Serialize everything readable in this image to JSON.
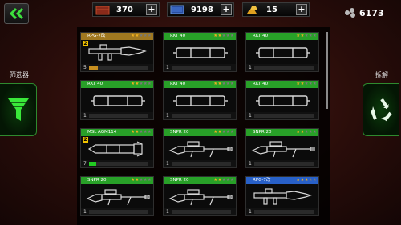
{
  "topbar": {
    "resources": [
      {
        "name": "crate",
        "value": "370",
        "plus": "+"
      },
      {
        "name": "cash",
        "value": "9198",
        "plus": "+"
      },
      {
        "name": "gold-bars",
        "value": "15",
        "plus": "+"
      }
    ],
    "balance": "6173"
  },
  "filter": {
    "label": "筛选器"
  },
  "disassemble": {
    "label": "拆解"
  },
  "cards": [
    {
      "name": "RPG-7改",
      "stars": 2,
      "header_color": "#a07820",
      "level": "2",
      "count": "5",
      "bar": 0.15,
      "bar_color": "#c89020",
      "item": "launcher"
    },
    {
      "name": "RKT 40",
      "stars": 2,
      "header_color": "#28a028",
      "level": "",
      "count": "1",
      "bar": 0,
      "bar_color": "#2c2",
      "item": "rocket"
    },
    {
      "name": "RKT 40",
      "stars": 2,
      "header_color": "#28a028",
      "level": "",
      "count": "1",
      "bar": 0,
      "bar_color": "#2c2",
      "item": "rocket"
    },
    {
      "name": "RKT 40",
      "stars": 2,
      "header_color": "#28a028",
      "level": "",
      "count": "1",
      "bar": 0,
      "bar_color": "#2c2",
      "item": "rocket"
    },
    {
      "name": "RKT 40",
      "stars": 2,
      "header_color": "#28a028",
      "level": "",
      "count": "1",
      "bar": 0,
      "bar_color": "#2c2",
      "item": "rocket"
    },
    {
      "name": "RKT 40",
      "stars": 2,
      "header_color": "#28a028",
      "level": "",
      "count": "1",
      "bar": 0,
      "bar_color": "#2c2",
      "item": "rocket"
    },
    {
      "name": "MSL AGM114",
      "stars": 2,
      "header_color": "#28a028",
      "level": "2",
      "count": "7",
      "bar": 0.12,
      "bar_color": "#2c2",
      "item": "missile"
    },
    {
      "name": "SNPR 20",
      "stars": 2,
      "header_color": "#28a028",
      "level": "",
      "count": "1",
      "bar": 0,
      "bar_color": "#2c2",
      "item": "sniper"
    },
    {
      "name": "SNPR 20",
      "stars": 2,
      "header_color": "#28a028",
      "level": "",
      "count": "1",
      "bar": 0,
      "bar_color": "#2c2",
      "item": "sniper"
    },
    {
      "name": "SNPR 20",
      "stars": 2,
      "header_color": "#28a028",
      "level": "",
      "count": "1",
      "bar": 0,
      "bar_color": "#2c2",
      "item": "sniper"
    },
    {
      "name": "SNPR 20",
      "stars": 2,
      "header_color": "#28a028",
      "level": "",
      "count": "1",
      "bar": 0,
      "bar_color": "#2c2",
      "item": "sniper"
    },
    {
      "name": "RPG-7改",
      "stars": 3,
      "header_color": "#2860c8",
      "level": "",
      "count": "1",
      "bar": 0,
      "bar_color": "#2c2",
      "item": "launcher"
    }
  ]
}
